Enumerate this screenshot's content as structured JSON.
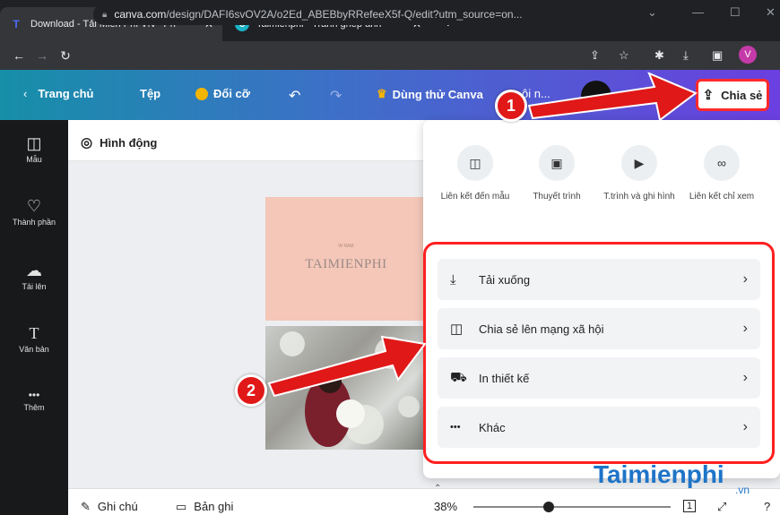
{
  "browser": {
    "tabs": [
      {
        "title": "Download - Tải Miễn Phí VN - Ph",
        "favicon": "T",
        "favicon_color": "#4a6cf7"
      },
      {
        "title": "Taimienphi - Tranh ghép ảnh",
        "favicon": "C",
        "favicon_color": "#1ab3c7"
      }
    ],
    "url_host": "canva.com",
    "url_path": "/design/DAFI6svOV2A/o2Ed_ABEBbyRRefeeX5f-Q/edit?utm_source=on...",
    "profile_initial": "V"
  },
  "header": {
    "home": "Trang chủ",
    "file": "Tệp",
    "resize": "Đổi cỡ",
    "trial": "Dùng thử Canva",
    "trial_extra": "ội n...",
    "share": "Chia sẻ"
  },
  "rail": [
    {
      "icon": "template-icon",
      "glyph": "◫",
      "label": "Mẫu"
    },
    {
      "icon": "elements-icon",
      "glyph": "♡",
      "label": "Thành phần"
    },
    {
      "icon": "upload-icon",
      "glyph": "☁",
      "label": "Tải lên"
    },
    {
      "icon": "text-icon",
      "glyph": "T",
      "label": "Văn bản"
    },
    {
      "icon": "more-icon",
      "glyph": "•••",
      "label": "Thêm"
    }
  ],
  "toolbar": {
    "animation": "Hình động"
  },
  "design": {
    "subtitle": "W NAM",
    "title": "TAIMIENPHI"
  },
  "share_panel": {
    "quick_actions": [
      {
        "icon": "template-link-icon",
        "glyph": "◫",
        "label": "Liên kết đến mẫu"
      },
      {
        "icon": "present-icon",
        "glyph": "▣",
        "label": "Thuyết trình"
      },
      {
        "icon": "record-icon",
        "glyph": "▶",
        "label": "T.trình và ghi hình"
      },
      {
        "icon": "view-link-icon",
        "glyph": "∞",
        "label": "Liên kết chỉ xem"
      }
    ],
    "options": [
      {
        "icon": "download-icon",
        "glyph": "⤓",
        "label": "Tải xuống"
      },
      {
        "icon": "social-share-icon",
        "glyph": "◫",
        "label": "Chia sẻ lên mạng xã hội"
      },
      {
        "icon": "print-truck-icon",
        "glyph": "⛟",
        "label": "In thiết kế"
      },
      {
        "icon": "more-dots-icon",
        "glyph": "•••",
        "label": "Khác"
      }
    ]
  },
  "bottom": {
    "notes": "Ghi chú",
    "record": "Bản ghi",
    "zoom": "38%",
    "zoom_value": 0.38,
    "page": "1"
  },
  "annotations": {
    "badge1": "1",
    "badge2": "2",
    "accent": "#e11818"
  },
  "watermark": {
    "brand": "Taimienphi",
    "tld": ".vn"
  }
}
